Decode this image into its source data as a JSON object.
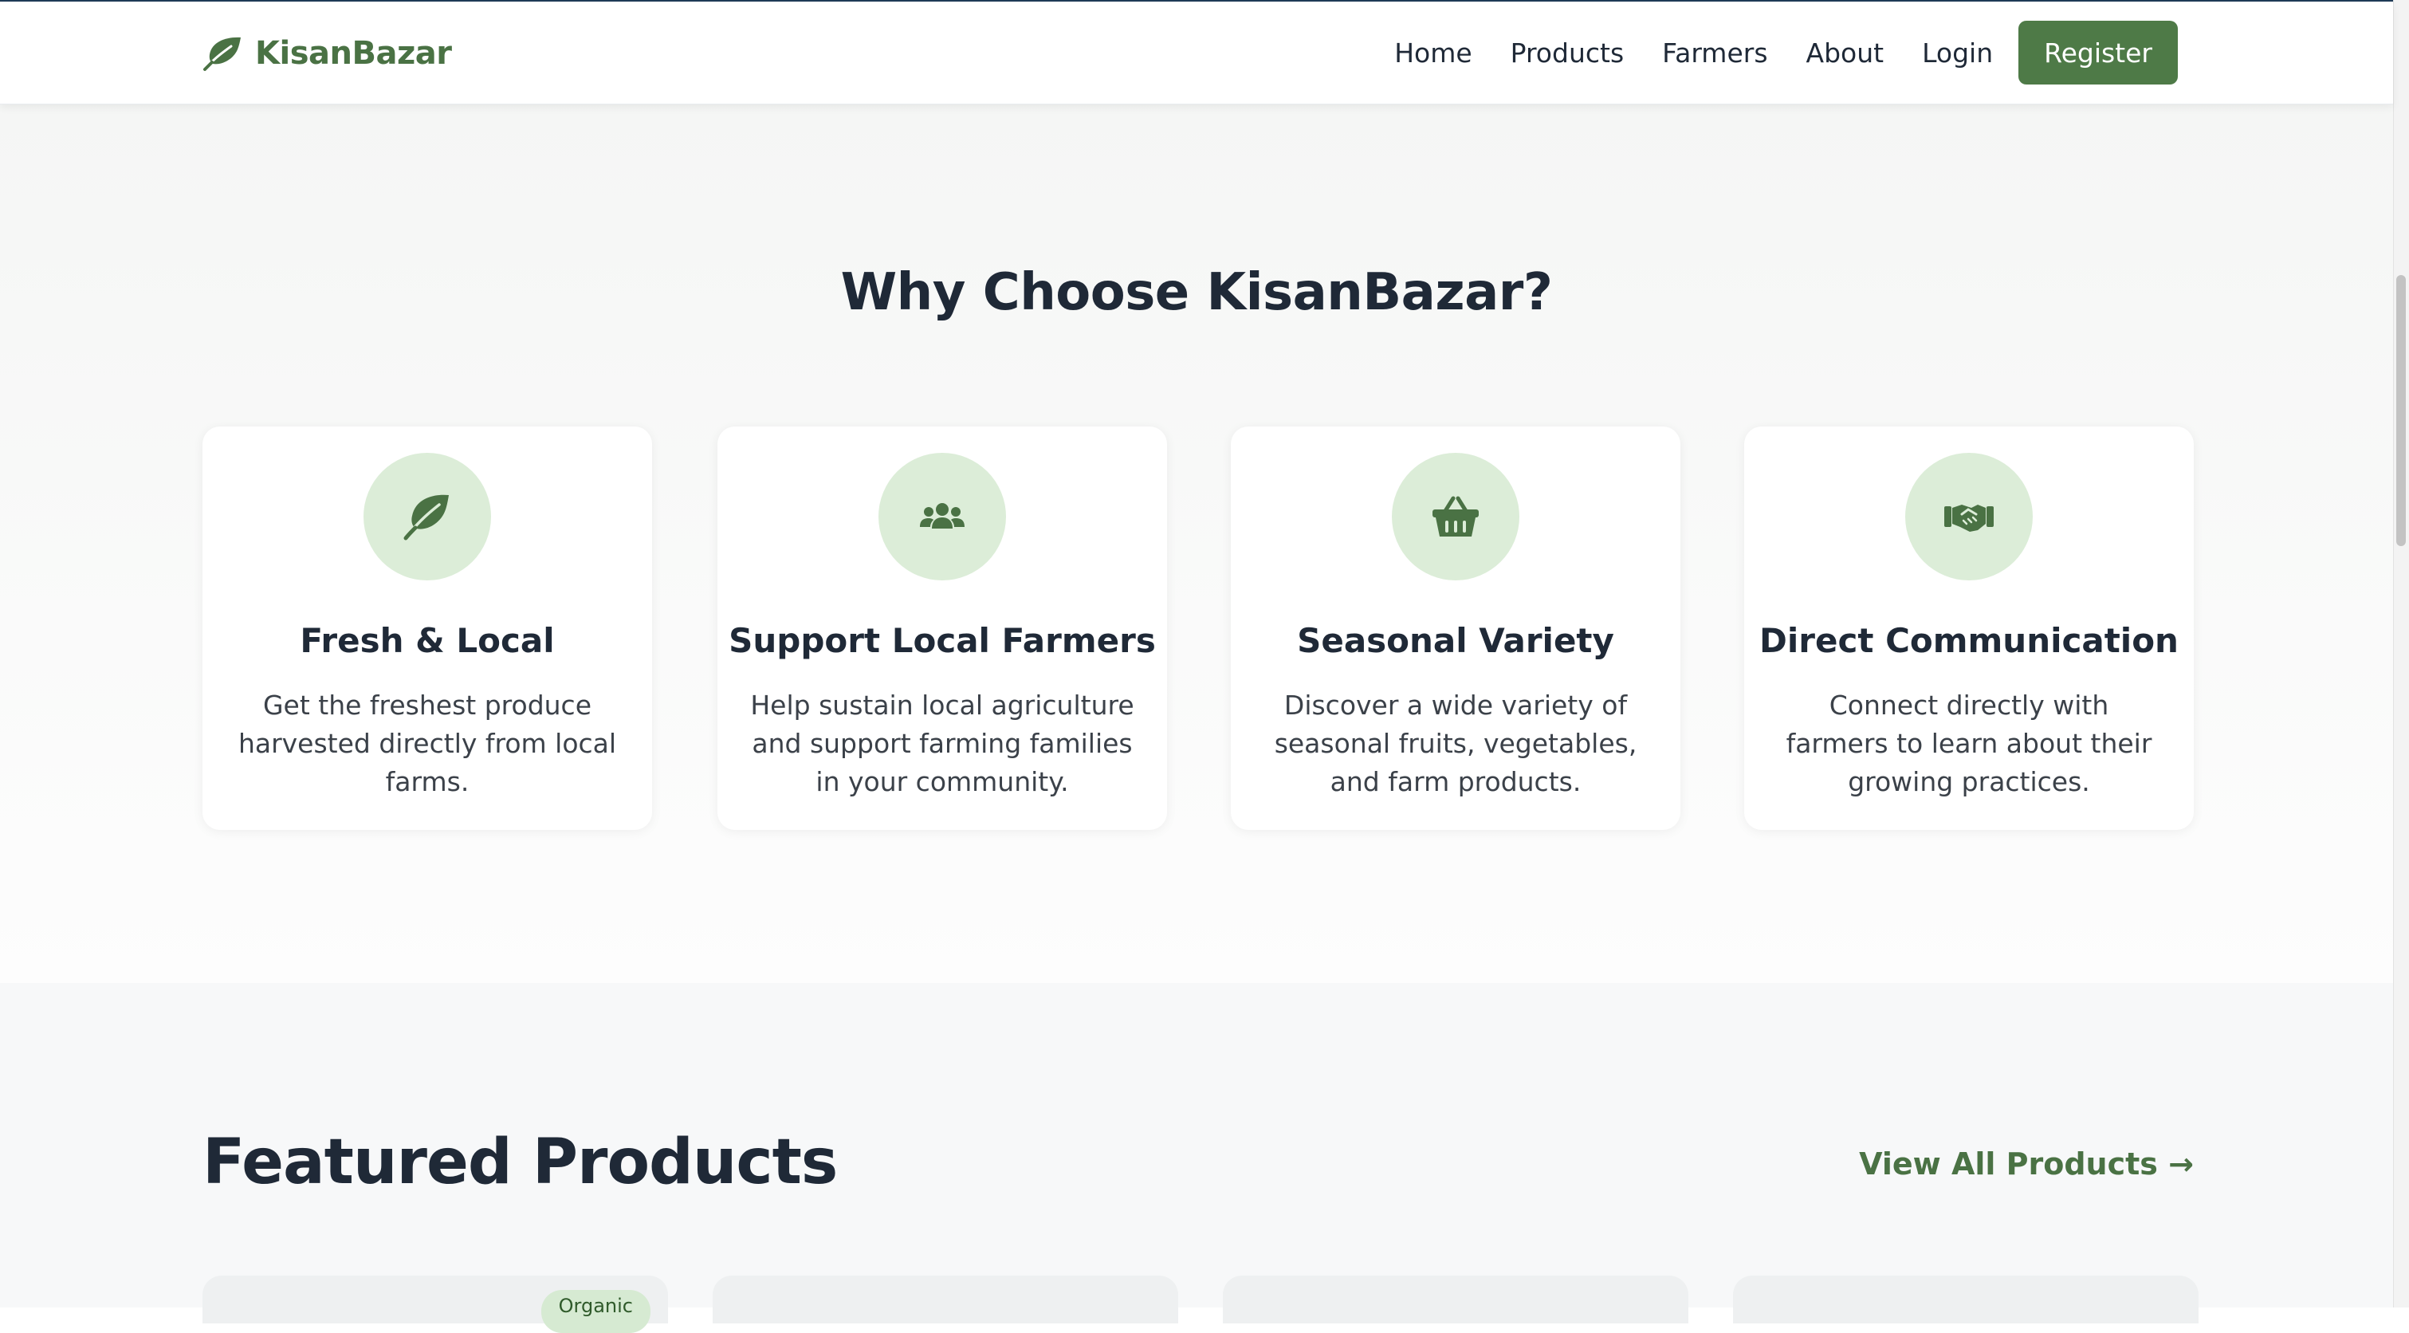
{
  "brand": {
    "name": "KisanBazar",
    "color": "#4a7244"
  },
  "nav": {
    "links": [
      "Home",
      "Products",
      "Farmers",
      "About",
      "Login"
    ],
    "register": "Register"
  },
  "why": {
    "title": "Why Choose KisanBazar?",
    "cards": [
      {
        "icon": "leaf-icon",
        "title": "Fresh & Local",
        "desc": "Get the freshest produce harvested directly from local farms."
      },
      {
        "icon": "users-icon",
        "title": "Support Local Farmers",
        "desc": "Help sustain local agriculture and support farming families in your community."
      },
      {
        "icon": "basket-icon",
        "title": "Seasonal Variety",
        "desc": "Discover a wide variety of seasonal fruits, vegetables, and farm products."
      },
      {
        "icon": "handshake-icon",
        "title": "Direct Communication",
        "desc": "Connect directly with farmers to learn about their growing practices."
      }
    ]
  },
  "featured": {
    "title": "Featured Products",
    "view_all": "View All Products →",
    "badge": "Organic"
  },
  "colors": {
    "accent": "#4e7a47",
    "icon_bg": "#dcedd8",
    "heading": "#1f2937"
  }
}
